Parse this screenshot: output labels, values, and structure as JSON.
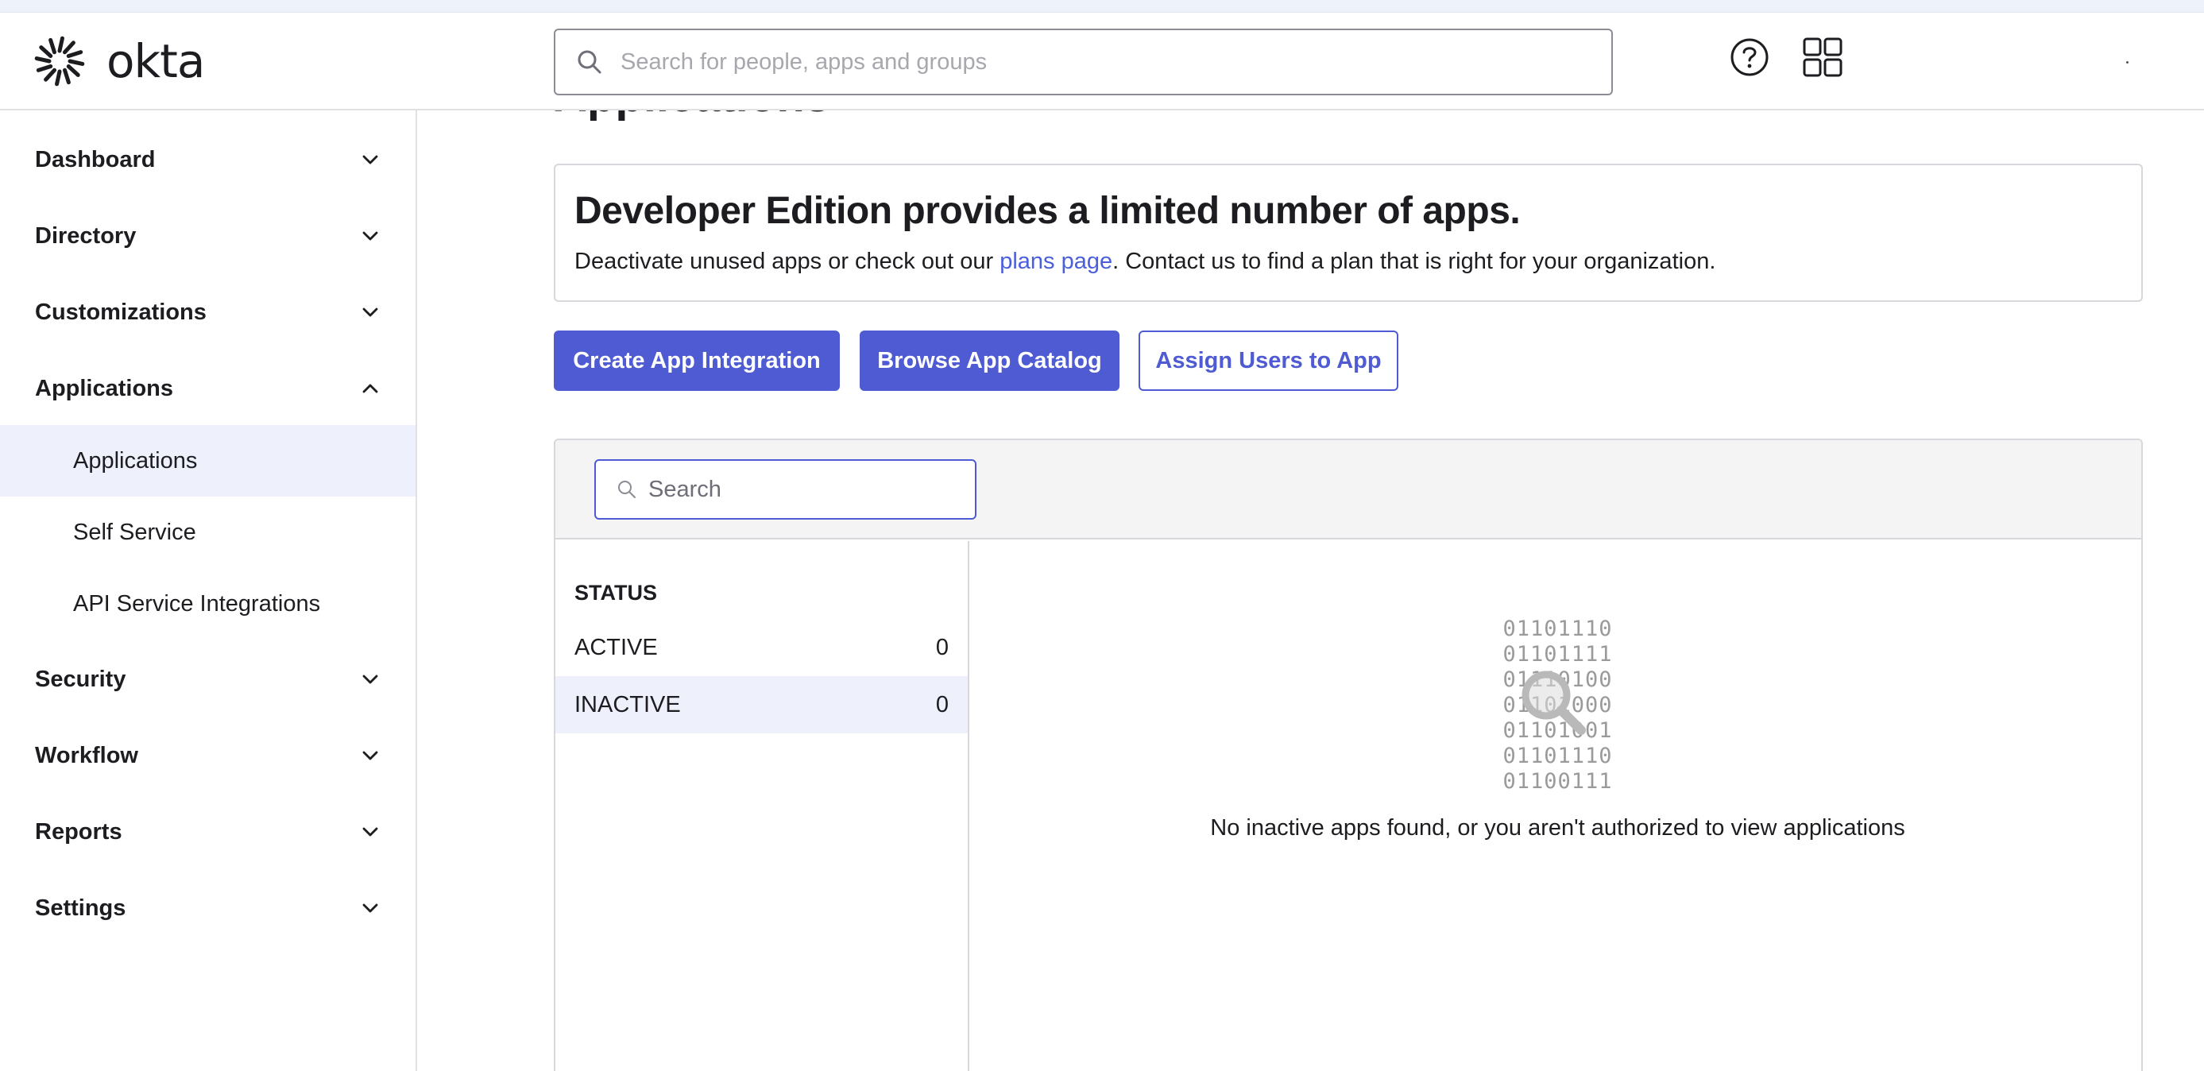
{
  "header": {
    "logo_text": "okta",
    "search_placeholder": "Search for people, apps and groups"
  },
  "sidebar": {
    "items": [
      {
        "label": "Dashboard",
        "expanded": false
      },
      {
        "label": "Directory",
        "expanded": false
      },
      {
        "label": "Customizations",
        "expanded": false
      },
      {
        "label": "Applications",
        "expanded": true,
        "children": [
          {
            "label": "Applications",
            "active": true
          },
          {
            "label": "Self Service",
            "active": false
          },
          {
            "label": "API Service Integrations",
            "active": false
          }
        ]
      },
      {
        "label": "Security",
        "expanded": false
      },
      {
        "label": "Workflow",
        "expanded": false
      },
      {
        "label": "Reports",
        "expanded": false
      },
      {
        "label": "Settings",
        "expanded": false
      }
    ]
  },
  "main": {
    "page_title": "Applications",
    "banner": {
      "title": "Developer Edition provides a limited number of apps.",
      "text_before": "Deactivate unused apps or check out our ",
      "link": "plans page",
      "text_after": ". Contact us to find a plan that is right for your organization."
    },
    "buttons": {
      "create": "Create App Integration",
      "browse": "Browse App Catalog",
      "assign": "Assign Users to App"
    },
    "panel": {
      "search_placeholder": "Search",
      "status_heading": "STATUS",
      "filters": [
        {
          "label": "ACTIVE",
          "count": "0",
          "selected": false
        },
        {
          "label": "INACTIVE",
          "count": "0",
          "selected": true
        }
      ],
      "binary_lines": [
        "01101110",
        "01101111",
        "01110100",
        "01101000",
        "01101001",
        "01101110",
        "01100111"
      ],
      "empty_message": "No inactive apps found, or you aren't authorized to view applications"
    }
  },
  "colors": {
    "accent": "#4e5bd3",
    "link": "#4a5fd9",
    "selected_bg": "#eef0fb"
  },
  "icons": [
    "okta-logo-icon",
    "search-icon",
    "help-icon",
    "app-grid-icon",
    "chevron-down-icon",
    "chevron-up-icon",
    "magnifier-icon"
  ]
}
